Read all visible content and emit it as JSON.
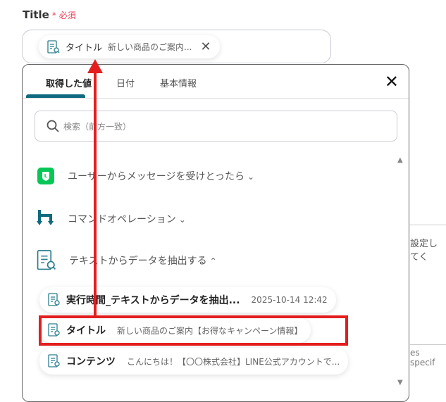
{
  "field": {
    "label": "Title",
    "required_mark": "*",
    "required_text": "必須",
    "chip": {
      "key": "タイトル",
      "value": "新しい商品のご案内..."
    }
  },
  "dropdown": {
    "tabs": [
      {
        "label": "取得した値",
        "active": true
      },
      {
        "label": "日付"
      },
      {
        "label": "基本情報"
      }
    ],
    "search_placeholder": "検索（前方一致）",
    "groups": [
      {
        "label": "ユーザーからメッセージを受けとったら",
        "icon": "line-icon",
        "expanded": false
      },
      {
        "label": "コマンドオペレーション",
        "icon": "command-operation-icon",
        "expanded": false
      },
      {
        "label": "テキストからデータを抽出する",
        "icon": "document-search-icon",
        "expanded": true
      }
    ],
    "items": [
      {
        "key": "実行時間_テキストからデータを抽出...",
        "value": "2025-10-14 12:42"
      },
      {
        "key": "タイトル",
        "value": "新しい商品のご案内【お得なキャンペーン情報】",
        "highlighted": true
      },
      {
        "key": "コンテンツ",
        "value": "こんにちは！【〇〇株式会社】LINE公式アカウントで..."
      }
    ]
  },
  "background": {
    "text1": "設定してく",
    "text2": "es specif"
  },
  "colors": {
    "accent": "#0f6a80",
    "required": "#e8425a",
    "annotation": "#e41e1e",
    "line_green": "#06c755"
  }
}
